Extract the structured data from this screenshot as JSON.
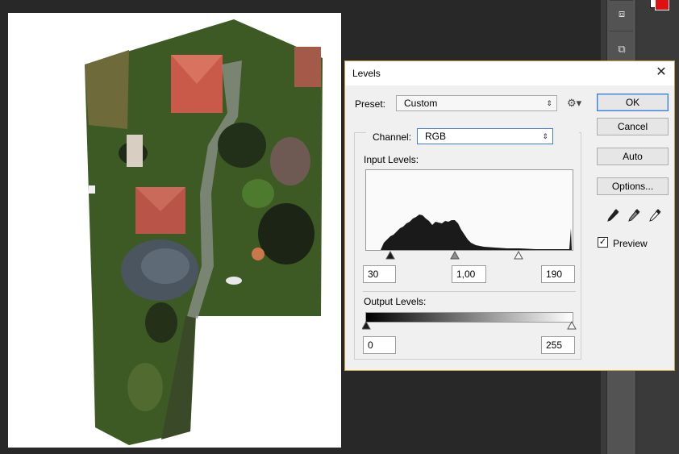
{
  "window": {
    "title": "Levels"
  },
  "preset": {
    "label": "Preset:",
    "value": "Custom"
  },
  "channel": {
    "label": "Channel:",
    "value": "RGB"
  },
  "input_levels": {
    "label": "Input Levels:",
    "black": "30",
    "gamma": "1,00",
    "white": "190"
  },
  "output_levels": {
    "label": "Output Levels:",
    "black": "0",
    "white": "255"
  },
  "buttons": {
    "ok": "OK",
    "cancel": "Cancel",
    "auto": "Auto",
    "options": "Options..."
  },
  "preview": {
    "label": "Preview",
    "checked": true
  },
  "colors": {
    "accent": "#3b7dd8",
    "foreground_swatch": "#e01010",
    "dialog_border": "#c9a23a"
  },
  "icons": [
    "gear-icon",
    "black-eyedropper-icon",
    "gray-eyedropper-icon",
    "white-eyedropper-icon",
    "close-icon",
    "3d-cube-icon",
    "path-tool-icon"
  ]
}
